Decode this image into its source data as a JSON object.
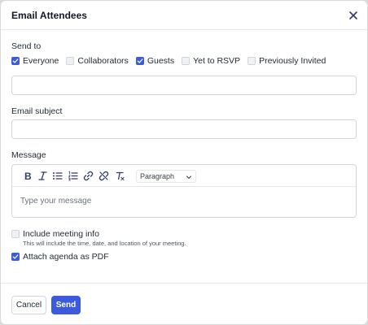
{
  "dialog": {
    "title": "Email Attendees",
    "close_icon": "close-icon"
  },
  "send_to": {
    "label": "Send to",
    "options": [
      {
        "label": "Everyone",
        "checked": true
      },
      {
        "label": "Collaborators",
        "checked": false
      },
      {
        "label": "Guests",
        "checked": true
      },
      {
        "label": "Yet to RSVP",
        "checked": false
      },
      {
        "label": "Previously Invited",
        "checked": false
      }
    ],
    "recipients_value": ""
  },
  "subject": {
    "label": "Email subject",
    "value": ""
  },
  "message": {
    "label": "Message",
    "placeholder": "Type your message",
    "toolbar": {
      "icons": [
        "bold-icon",
        "italic-icon",
        "bullet-list-icon",
        "numbered-list-icon",
        "link-icon",
        "unlink-icon",
        "clear-format-icon"
      ],
      "format_value": "Paragraph"
    }
  },
  "options": {
    "include_info": {
      "label": "Include meeting info",
      "hint": "This will include the time, date, and location of your meeting.",
      "checked": false
    },
    "attach_pdf": {
      "label": "Attach agenda as PDF",
      "checked": true
    }
  },
  "footer": {
    "cancel_label": "Cancel",
    "send_label": "Send"
  },
  "colors": {
    "accent": "#3b5bdb",
    "border": "#d1d5db"
  }
}
